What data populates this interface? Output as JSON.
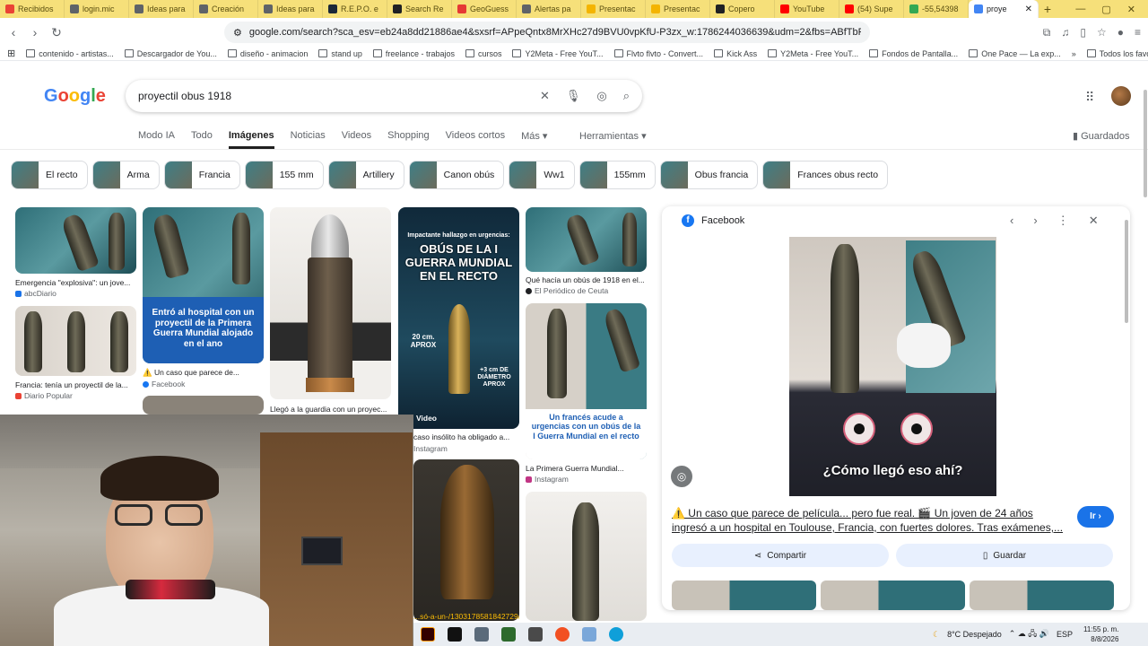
{
  "browser": {
    "tabs": [
      {
        "label": "Recibidos",
        "color": "#ea4335"
      },
      {
        "label": "login.mic",
        "color": "#5f6368"
      },
      {
        "label": "Ideas para",
        "color": "#5f6368"
      },
      {
        "label": "Creación",
        "color": "#5f6368"
      },
      {
        "label": "Ideas para",
        "color": "#5f6368"
      },
      {
        "label": "R.E.P.O. e",
        "color": "#1b2838"
      },
      {
        "label": "Search Re",
        "color": "#202124"
      },
      {
        "label": "GeoGuess",
        "color": "#e53935"
      },
      {
        "label": "Alertas pa",
        "color": "#5f6368"
      },
      {
        "label": "Presentac",
        "color": "#f4b400"
      },
      {
        "label": "Presentac",
        "color": "#f4b400"
      },
      {
        "label": "Copero",
        "color": "#202124"
      },
      {
        "label": "YouTube",
        "color": "#ff0000"
      },
      {
        "label": "(54) Supe",
        "color": "#ff0000"
      },
      {
        "label": "-55,54398",
        "color": "#34a853"
      },
      {
        "label": "proye",
        "color": "#4285f4"
      }
    ],
    "new_tab": "+",
    "url": "google.com/search?sca_esv=eb24a8dd21886ae4&sxsrf=APpeQntx8MrXHc27d9BVU0vpKfU-P3zx_w:1786244036639&udm=2&fbs=ABfTbFUDadgeu2mn...",
    "bookmarks": [
      "contenido - artistas...",
      "Descargador de You...",
      "diseño - animacion",
      "stand up",
      "freelance - trabajos",
      "cursos",
      "Y2Meta - Free YouT...",
      "Flvto flvto - Convert...",
      "Kick Ass",
      "Y2Meta - Free YouT...",
      "Fondos de Pantalla...",
      "One Pace — La exp..."
    ],
    "bookmarks_more": "»",
    "all_favorites": "Todos los favoritos"
  },
  "google": {
    "logo": "Google",
    "query": "proyectil obus 1918",
    "nav": [
      "Modo IA",
      "Todo",
      "Imágenes",
      "Noticias",
      "Videos",
      "Shopping",
      "Videos cortos",
      "Más ▾"
    ],
    "active_nav": "Imágenes",
    "tools": "Herramientas ▾",
    "saved": "Guardados",
    "chips": [
      "El recto",
      "Arma",
      "Francia",
      "155 mm",
      "Artillery",
      "Canon obús",
      "Ww1",
      "155mm",
      "Obus francia",
      "Frances obus recto"
    ]
  },
  "results": {
    "r1_caption": "Emergencia \"explosiva\": un jove...",
    "r1_source": "abcDiario",
    "r2_caption": "Francia: tenía un proyectil de la...",
    "r2_source": "Diario Popular",
    "r3_banner": "Entró al hospital con un proyectil de la Primera Guerra Mundial alojado en el ano",
    "r3_caption": "⚠️ Un caso que parece de...",
    "r3_source": "Facebook",
    "r4_caption": "Llegó a la guardia con un proyec...",
    "r5_banner_top": "Impactante hallazgo en urgencias:",
    "r5_banner_main": "OBÚS DE LA I GUERRA MUNDIAL EN EL RECTO",
    "r5_measure": "20 cm. APROX",
    "r5_diameter": "+3 cm DE DIÁMETRO APROX",
    "r5_video": "Video",
    "r5_caption": "caso insólito ha obligado a...",
    "r5_source": "Instagram",
    "r6_caption": "Qué hacía un obús de 1918 en el...",
    "r6_source": "El Periódico de Ceuta",
    "r7_banner": "Un francés acude a urgencias con un obús de la I Guerra Mundial en el recto",
    "r7_caption": "La Primera Guerra Mundial...",
    "r7_source": "Instagram",
    "r8_url": "...só-a-un-/1303178581842729/"
  },
  "panel": {
    "source": "Facebook",
    "meme_text": "¿Cómo llegó eso ahí?",
    "title": "⚠️ Un caso que parece de película... pero fue real. 🎬 Un joven de 24 años ingresó a un hospital en Toulouse, Francia, con fuertes dolores. Tras exámenes,...",
    "go": "Ir ›",
    "share": "Compartir",
    "save": "Guardar"
  },
  "taskbar": {
    "weather": "8°C  Despejado",
    "lang": "ESP",
    "time": "11:55 p. m.",
    "date": "8/8/2026"
  }
}
